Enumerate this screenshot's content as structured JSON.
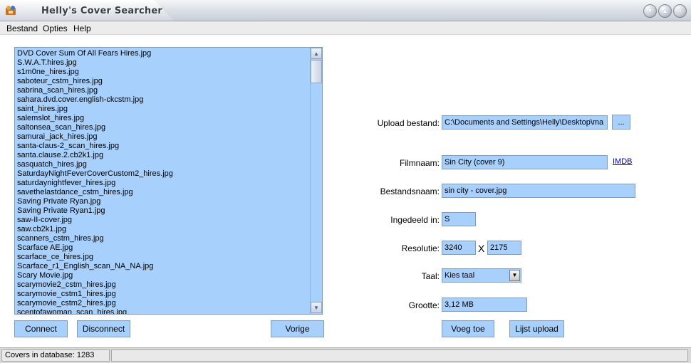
{
  "window": {
    "title": "Helly's Cover Searcher"
  },
  "menu": {
    "bestand": "Bestand",
    "opties": "Opties",
    "help": "Help"
  },
  "file_list": [
    "DVD Cover Sum Of All Fears Hires.jpg",
    "S.W.A.T.hires.jpg",
    "s1m0ne_hires.jpg",
    "saboteur_cstm_hires.jpg",
    "sabrina_scan_hires.jpg",
    "sahara.dvd.cover.english-ckcstm.jpg",
    "saint_hires.jpg",
    "salemslot_hires.jpg",
    "saltonsea_scan_hires.jpg",
    "samurai_jack_hires.jpg",
    "santa-claus-2_scan_hires.jpg",
    "santa.clause.2.cb2k1.jpg",
    "sasquatch_hires.jpg",
    "SaturdayNightFeverCoverCustom2_hires.jpg",
    "saturdaynightfever_hires.jpg",
    "savethelastdance_cstm_hires.jpg",
    "Saving Private Ryan.jpg",
    "Saving Private Ryan1.jpg",
    "saw-II-cover.jpg",
    "saw.cb2k1.jpg",
    "scanners_cstm_hires.jpg",
    "Scarface AE.jpg",
    "scarface_ce_hires.jpg",
    "Scarface_r1_English_scan_NA_NA.jpg",
    "Scary Movie.jpg",
    "scarymovie2_cstm_hires.jpg",
    "scarymovie_cstm1_hires.jpg",
    "scarymovie_cstm2_hires.jpg",
    "scentofawoman_scan_hires.jpg"
  ],
  "buttons": {
    "connect": "Connect",
    "disconnect": "Disconnect",
    "vorige": "Vorige",
    "browse": "...",
    "voeg_toe": "Voeg toe",
    "lijst_upload": "Lijst upload"
  },
  "form": {
    "upload_label": "Upload bestand:",
    "upload_value": "C:\\Documents and Settings\\Helly\\Desktop\\ma",
    "filmnaam_label": "Filmnaam:",
    "filmnaam_value": "Sin City (cover 9)",
    "imdb_link": "IMDB",
    "bestandsnaam_label": "Bestandsnaam:",
    "bestandsnaam_value": "sin city - cover.jpg",
    "ingedeeld_label": "Ingedeeld in:",
    "ingedeeld_value": "S",
    "resolutie_label": "Resolutie:",
    "res_width": "3240",
    "res_sep": "X",
    "res_height": "2175",
    "taal_label": "Taal:",
    "taal_value": "Kies taal",
    "grootte_label": "Grootte:",
    "grootte_value": "3,12 MB"
  },
  "status": {
    "covers_count": "Covers in database: 1283",
    "second_panel": ""
  }
}
